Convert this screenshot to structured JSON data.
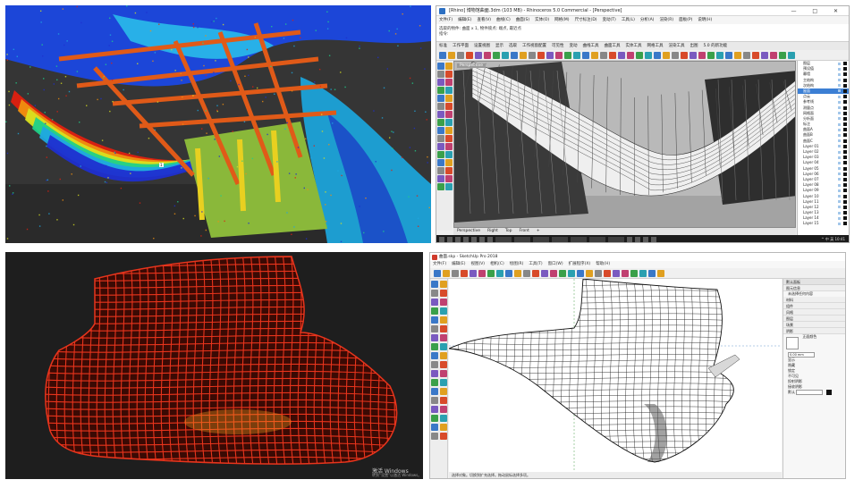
{
  "scan_pointcloud": {
    "annotation_label": "1",
    "colors": {
      "background": "#3a3a3a",
      "ramp": [
        "#1f2fd0",
        "#1fa8e0",
        "#20d08a",
        "#d8e020",
        "#f09010",
        "#e02010"
      ]
    }
  },
  "rhino": {
    "title": "[Rhino] 博物馆曲面.3dm (103 MB) - Rhinoceros 5.0 Commercial - [Perspective]",
    "window_controls": "— □ ✕",
    "menu": [
      "文件(F)",
      "编辑(E)",
      "查看(V)",
      "曲线(C)",
      "曲面(S)",
      "实体(O)",
      "网格(M)",
      "尺寸标注(D)",
      "变动(T)",
      "工具(L)",
      "分析(A)",
      "渲染(R)",
      "面板(P)",
      "说明(H)"
    ],
    "command_history": "选取的物件: 曲面 x 1,  物件锁点: 端点, 最近点",
    "command_prompt": "指令:",
    "tabs": [
      "标准",
      "工作平面",
      "设置视图",
      "显示",
      "选取",
      "工作视窗配置",
      "可见性",
      "变动",
      "曲线工具",
      "曲面工具",
      "实体工具",
      "网格工具",
      "渲染工具",
      "出图",
      "5.0 的新功能"
    ],
    "viewport_label": "Perspective",
    "viewport_tabs": [
      "Perspective",
      "Right",
      "Top",
      "Front",
      "+"
    ],
    "layers": [
      {
        "name": "图层",
        "selected": false
      },
      {
        "name": "预设值",
        "selected": false
      },
      {
        "name": "幕墙",
        "selected": false
      },
      {
        "name": "主结构",
        "selected": false
      },
      {
        "name": "次结构",
        "selected": false
      },
      {
        "name": "屋面",
        "selected": true
      },
      {
        "name": "点云",
        "selected": false
      },
      {
        "name": "参考线",
        "selected": false
      },
      {
        "name": "测量点",
        "selected": false
      },
      {
        "name": "网格面",
        "selected": false
      },
      {
        "name": "分析面",
        "selected": false
      },
      {
        "name": "标注",
        "selected": false
      },
      {
        "name": "曲面A",
        "selected": false
      },
      {
        "name": "曲面B",
        "selected": false
      },
      {
        "name": "曲面C",
        "selected": false
      },
      {
        "name": "Layer 01",
        "selected": false
      },
      {
        "name": "Layer 02",
        "selected": false
      },
      {
        "name": "Layer 03",
        "selected": false
      },
      {
        "name": "Layer 04",
        "selected": false
      },
      {
        "name": "Layer 05",
        "selected": false
      },
      {
        "name": "Layer 06",
        "selected": false
      },
      {
        "name": "Layer 07",
        "selected": false
      },
      {
        "name": "Layer 08",
        "selected": false
      },
      {
        "name": "Layer 09",
        "selected": false
      },
      {
        "name": "Layer 10",
        "selected": false
      },
      {
        "name": "Layer 11",
        "selected": false
      },
      {
        "name": "Layer 12",
        "selected": false
      },
      {
        "name": "Layer 13",
        "selected": false
      },
      {
        "name": "Layer 14",
        "selected": false
      },
      {
        "name": "Layer 15",
        "selected": false
      }
    ],
    "taskbar_tray": "^ 中 英  10:41"
  },
  "mesh_view": {
    "watermark_title": "激活 Windows",
    "watermark_sub": "转到“设置”以激活 Windows。",
    "colors": {
      "background": "#1e1e1e",
      "mesh": "#e8341c",
      "highlight": "#f8a020"
    }
  },
  "sketchup": {
    "title": "曲面.skp - SketchUp Pro 2018",
    "menu": [
      "文件(F)",
      "编辑(E)",
      "视图(V)",
      "相机(C)",
      "绘图(R)",
      "工具(T)",
      "窗口(W)",
      "扩展程序(X)",
      "帮助(H)"
    ],
    "status_text": "选择对象。切换到扩充选择。拖动鼠标选择多项。",
    "tray": {
      "title": "默认面板",
      "sections": [
        "图元信息",
        "材料",
        "组件",
        "风格",
        "图层",
        "场景",
        "阴影"
      ],
      "entity_info": "未选择任何内容",
      "material_name": "正面颜色",
      "input_value": "0.00 mm",
      "options": [
        "显示",
        "隐藏",
        "锁定",
        "不可见",
        "投射阴影",
        "接收阴影"
      ],
      "bottom_label": "默认"
    }
  }
}
